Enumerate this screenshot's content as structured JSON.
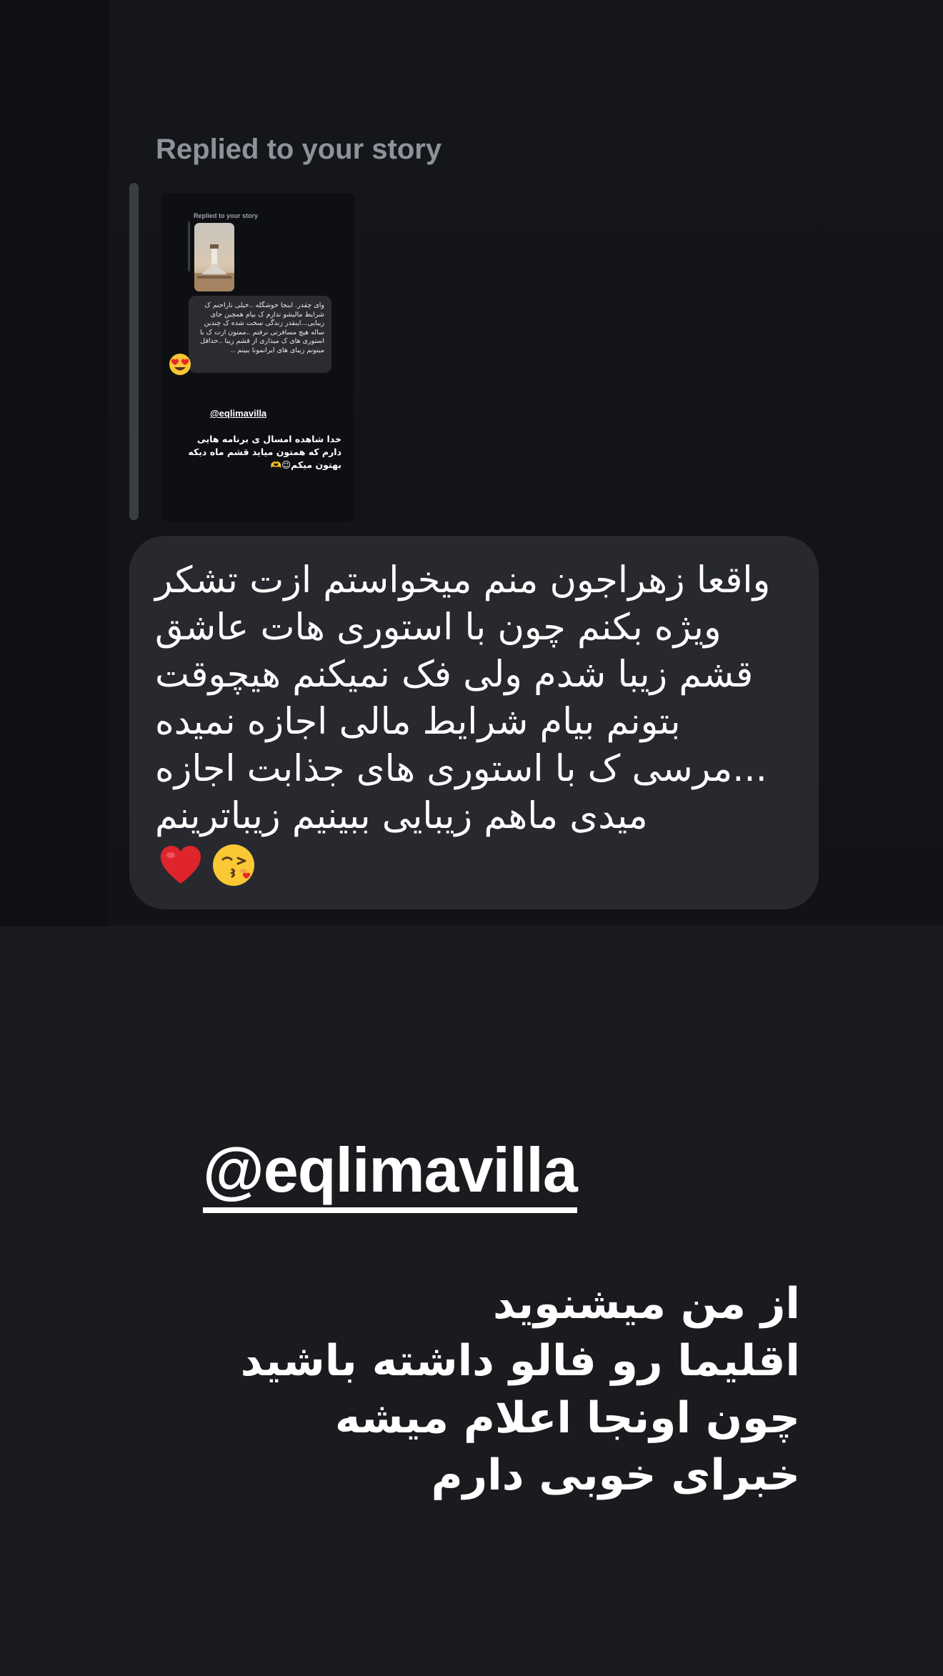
{
  "reply": {
    "header": "Replied to your story"
  },
  "story": {
    "mini_header": "Replied to your story",
    "mini_bubble_text": "وای چقدر. اینجا خوشگله ..خیلی ناراحتم ک شرایط مالیشو ندارم ک بیام همچین جای زیبایی...اینقدر زندگی سخت شده ک چندین ساله هیچ مسافرتی نرفتم ..ممنون ازت ک با استوری های ک میذاری از قشم زیبا ..حداقل میتونم زیبای های ایرانمونا ببینم ..",
    "mini_emoji": "heart-eyes-emoji",
    "handle": "@eqlimavilla",
    "caption": "خدا شاهده امسال ی برنامه هایی دارم که همتون میاید قشم ماه دیکه بهتون میکم😉🫶"
  },
  "message": {
    "text": "واقعا زهراجون منم میخواستم ازت تشکر ویژه بکنم چون با استوری هات عاشق قشم زیبا شدم ولی فک نمیکنم هیچوقت بتونم بیام شرایط مالی اجازه نمیده ...مرسی ک با استوری های جذابت اجازه میدی ماهم زیبایی ببینیم زیباترینم",
    "emojis": [
      "heart-emoji",
      "kissing-face-emoji"
    ]
  },
  "overlay": {
    "handle": "@eqlimavilla",
    "caption": "از من میشنوید\nاقلیما رو فالو داشته باشید\nچون اونجا اعلام میشه\nخبرای خوبی دارم"
  },
  "colors": {
    "background": "#191b1f",
    "dm_background": "#111317",
    "bubble": "#27292e",
    "header_text": "#8e939b",
    "reply_bar": "#3a3d43",
    "text": "#ffffff"
  }
}
